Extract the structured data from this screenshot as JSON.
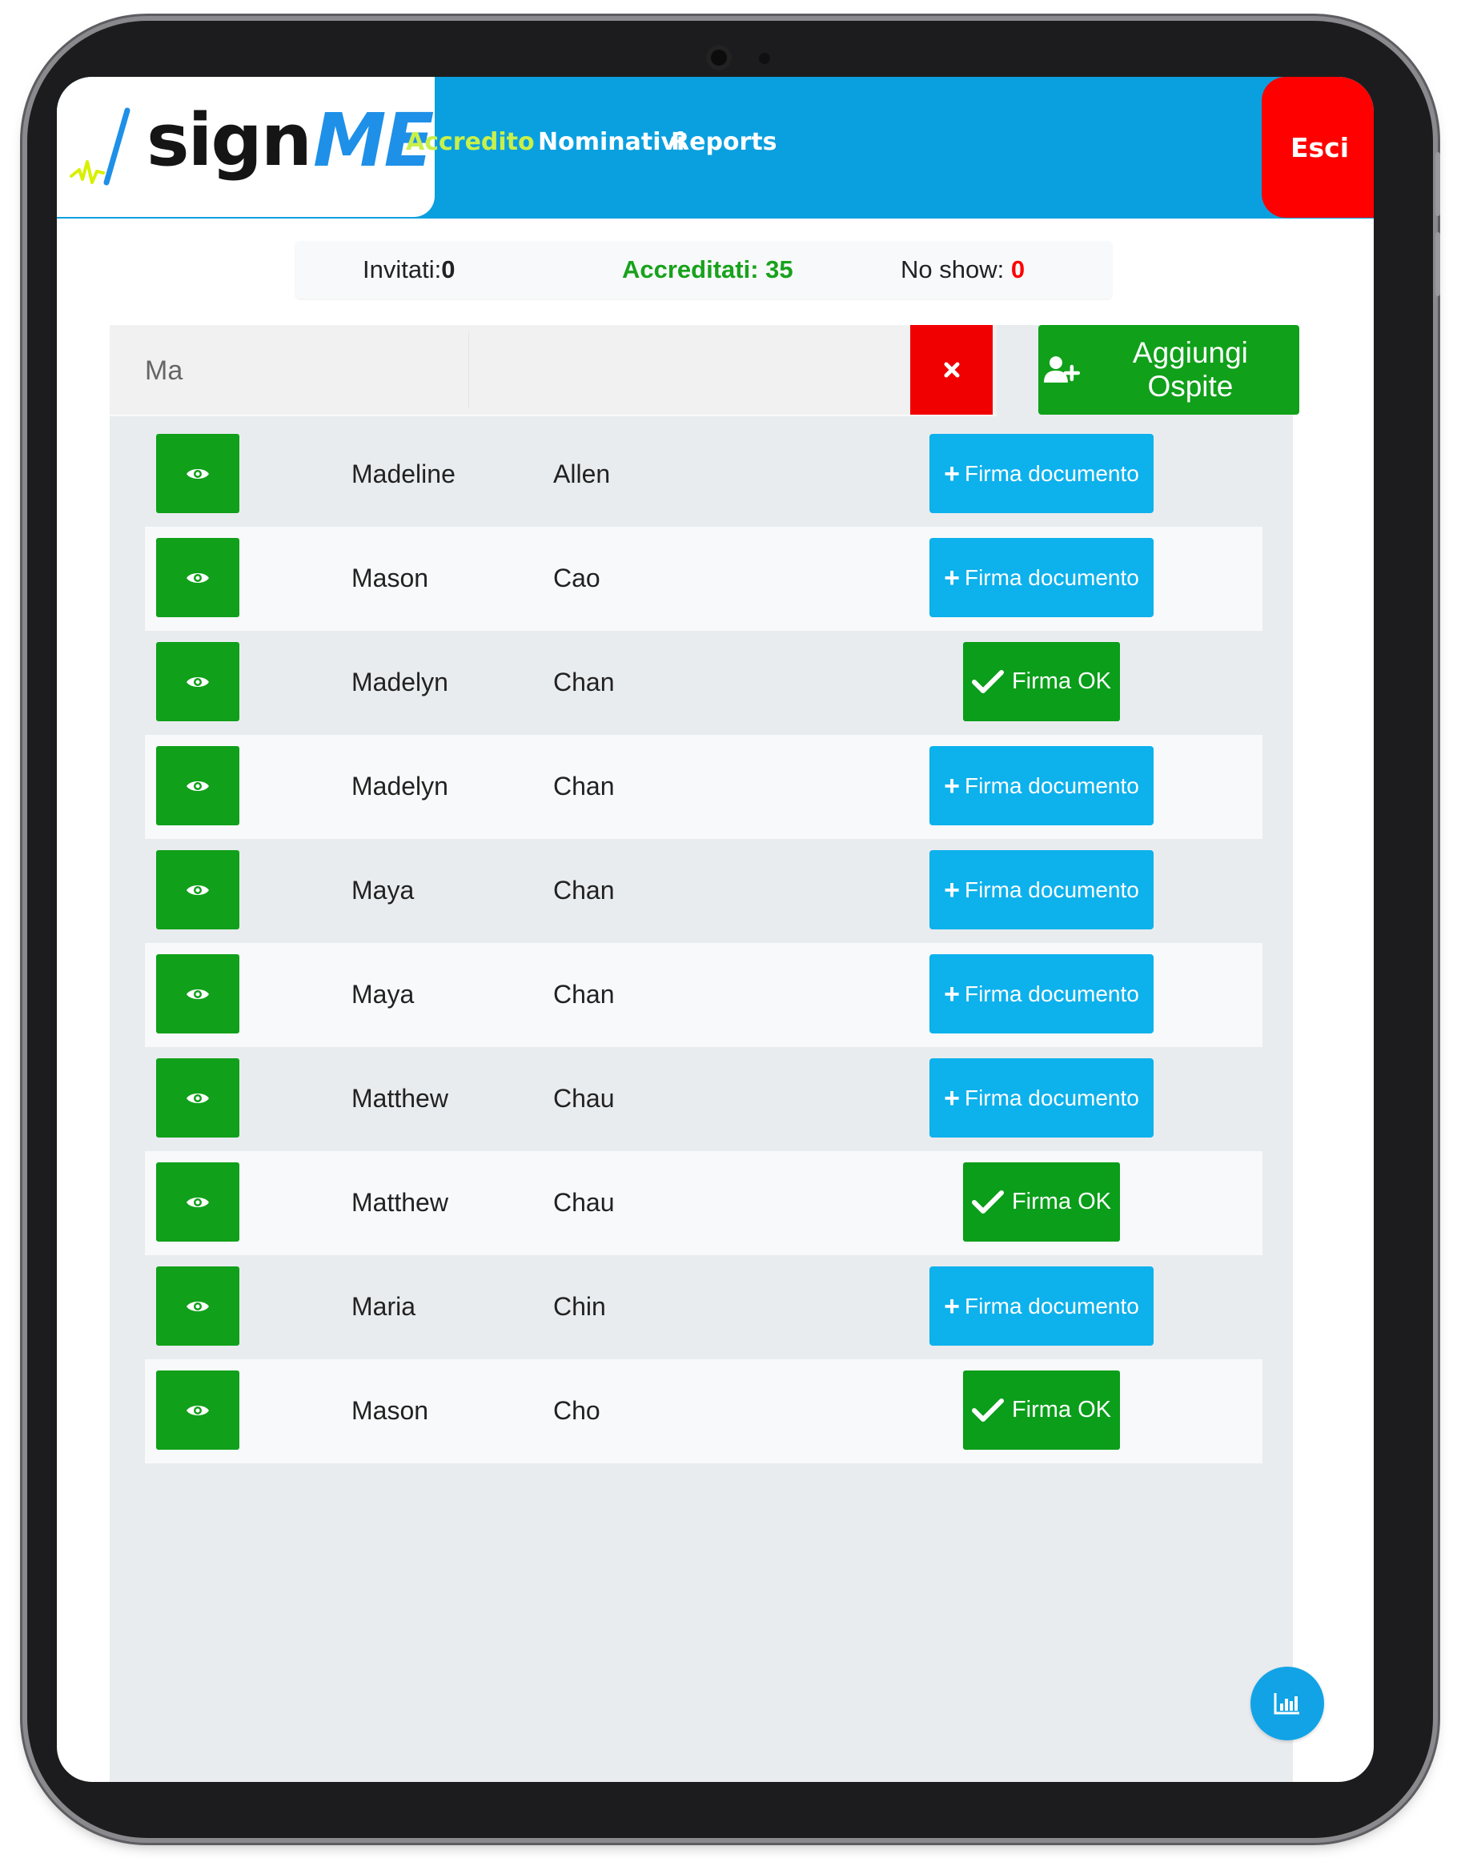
{
  "brand": {
    "name_part1": "sign",
    "name_part2": "ME"
  },
  "nav": {
    "items": [
      {
        "label": "Accredito",
        "active": true
      },
      {
        "label": "Nominativi",
        "active": false
      },
      {
        "label": "Reports",
        "active": false
      }
    ],
    "exit_label": "Esci"
  },
  "stats": {
    "invited_label": "Invitati:",
    "invited_value": "0",
    "accredited_label": "Accreditati: 35",
    "noshow_label": "No show: ",
    "noshow_value": "0"
  },
  "search": {
    "value": "Ma",
    "placeholder": ""
  },
  "toolbar": {
    "add_guest_label": "Aggiungi Ospite"
  },
  "guests": [
    {
      "first": "Madeline",
      "last": "Allen",
      "status": "sign",
      "action_label": "Firma documento"
    },
    {
      "first": "Mason",
      "last": "Cao",
      "status": "sign",
      "action_label": "Firma documento"
    },
    {
      "first": "Madelyn",
      "last": "Chan",
      "status": "ok",
      "action_label": "Firma OK"
    },
    {
      "first": "Madelyn",
      "last": "Chan",
      "status": "sign",
      "action_label": "Firma documento"
    },
    {
      "first": "Maya",
      "last": "Chan",
      "status": "sign",
      "action_label": "Firma documento"
    },
    {
      "first": "Maya",
      "last": "Chan",
      "status": "sign",
      "action_label": "Firma documento"
    },
    {
      "first": "Matthew",
      "last": "Chau",
      "status": "sign",
      "action_label": "Firma documento"
    },
    {
      "first": "Matthew",
      "last": "Chau",
      "status": "ok",
      "action_label": "Firma OK"
    },
    {
      "first": "Maria",
      "last": "Chin",
      "status": "sign",
      "action_label": "Firma documento"
    },
    {
      "first": "Mason",
      "last": "Cho",
      "status": "ok",
      "action_label": "Firma OK"
    }
  ],
  "colors": {
    "header": "#0aa0e0",
    "nav_active": "#c8f04a",
    "exit": "#ff0000",
    "green": "#10a01a",
    "sign_blue": "#0db1ec",
    "accredited_text": "#18a21c",
    "noshow_text": "#ff0000"
  },
  "icons": {
    "view": "eye-icon",
    "clear": "close-icon",
    "add_guest": "user-plus-icon",
    "sign": "plus-icon",
    "ok": "check-icon",
    "fab": "bar-chart-icon"
  }
}
